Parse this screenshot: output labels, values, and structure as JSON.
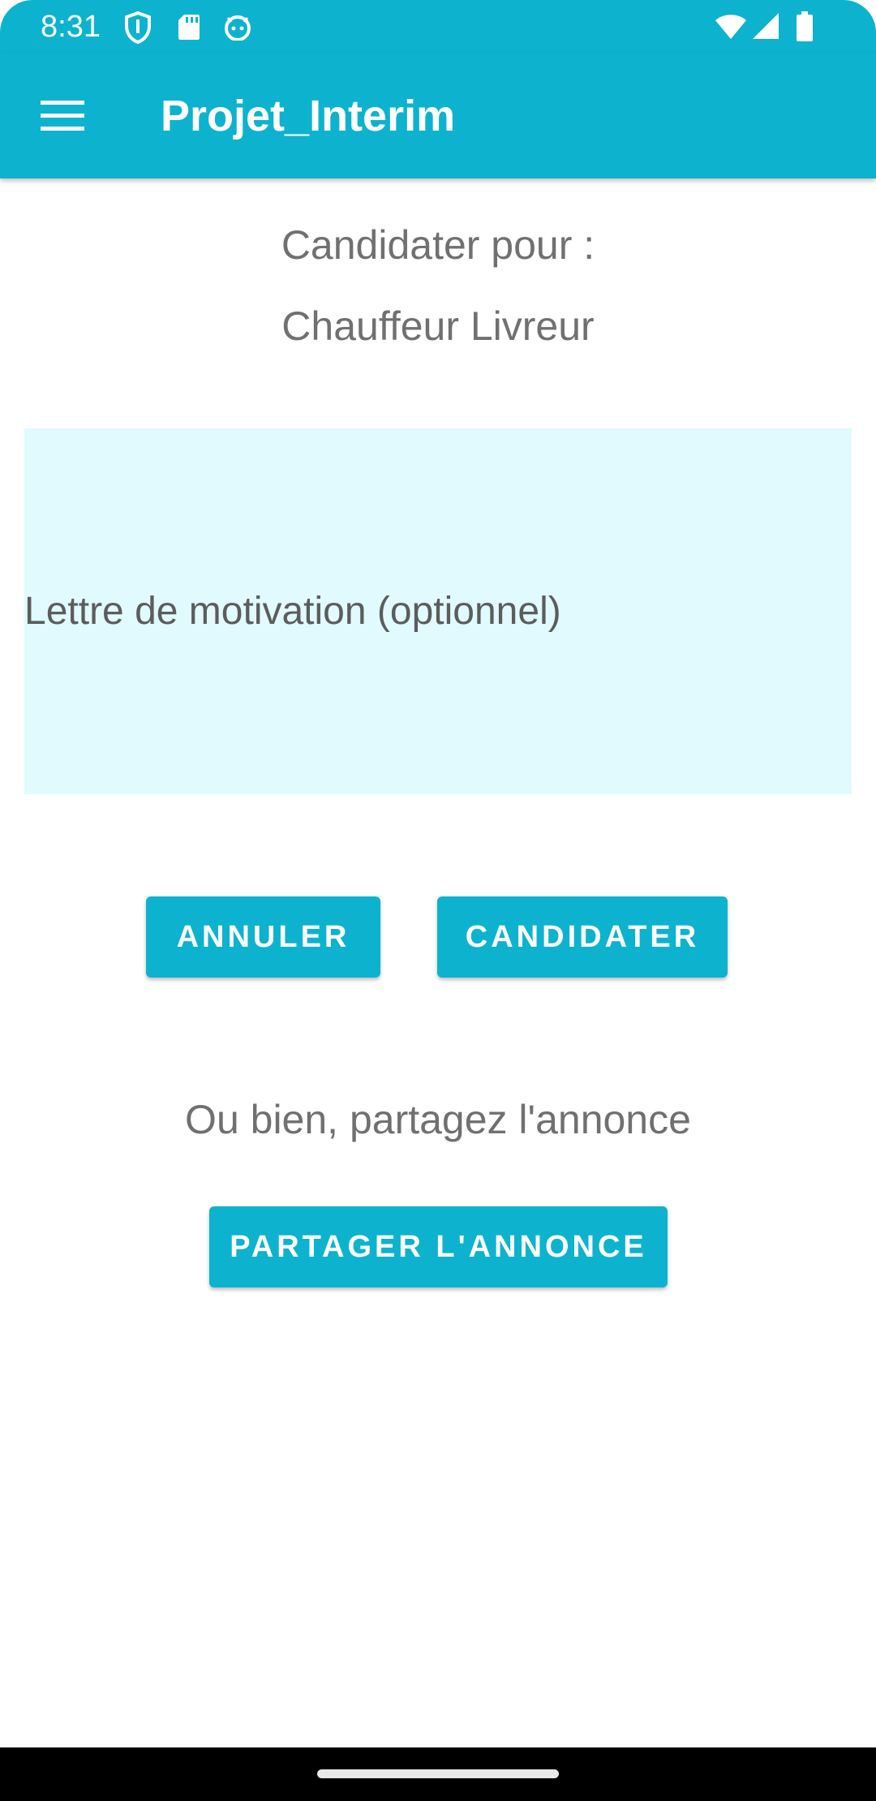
{
  "status_bar": {
    "time": "8:31",
    "left_icons": [
      "shield-icon",
      "sd-card-icon",
      "android-icon"
    ],
    "right_icons": [
      "wifi-icon",
      "cell-signal-icon",
      "battery-icon"
    ]
  },
  "app_bar": {
    "menu_icon": "hamburger-menu-icon",
    "title": "Projet_Interim"
  },
  "main": {
    "apply_for_label": "Candidater pour :",
    "job_title": "Chauffeur Livreur",
    "motivation_placeholder": "Lettre de motivation (optionnel)",
    "motivation_value": "",
    "cancel_label": "ANNULER",
    "apply_label": "CANDIDATER",
    "share_prompt": "Ou bien, partagez l'annonce",
    "share_label": "PARTAGER L'ANNONCE"
  },
  "colors": {
    "primary": "#0db3ce",
    "input_background": "#e0fafd",
    "text_gray": "#707070"
  }
}
